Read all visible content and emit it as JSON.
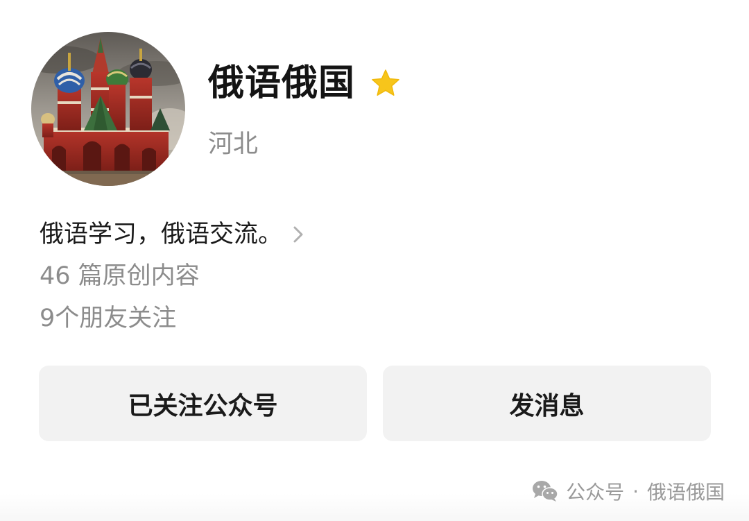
{
  "profile": {
    "name": "俄语俄国",
    "region": "河北",
    "intro": "俄语学习，俄语交流。",
    "articles": "46 篇原创内容",
    "friends": "9个朋友关注"
  },
  "actions": {
    "follow_label": "已关注公众号",
    "message_label": "发消息"
  },
  "watermark": {
    "platform": "公众号",
    "separator": "·",
    "account": "俄语俄国"
  },
  "icons": {
    "star": "star-icon",
    "chevron": "chevron-right-icon",
    "wechat": "wechat-icon",
    "avatar": "cathedral-image"
  },
  "colors": {
    "star": "#f7c51b",
    "muted_text": "#8c8c8c",
    "button_bg": "#f2f2f2"
  }
}
